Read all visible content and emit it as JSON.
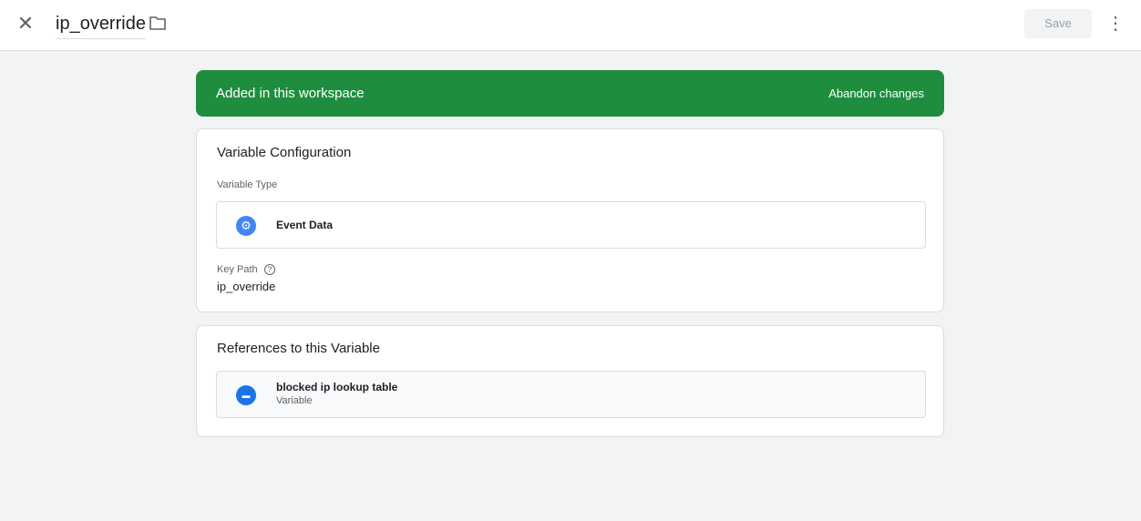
{
  "header": {
    "title": "ip_override",
    "save_label": "Save"
  },
  "banner": {
    "status": "Added in this workspace",
    "action": "Abandon changes",
    "color": "#1e8e3e"
  },
  "config": {
    "heading": "Variable Configuration",
    "type_label": "Variable Type",
    "type_value": "Event Data",
    "key_path_label": "Key Path",
    "key_path_value": "ip_override"
  },
  "references": {
    "heading": "References to this Variable",
    "items": [
      {
        "name": "blocked ip lookup table",
        "type": "Variable"
      }
    ]
  }
}
